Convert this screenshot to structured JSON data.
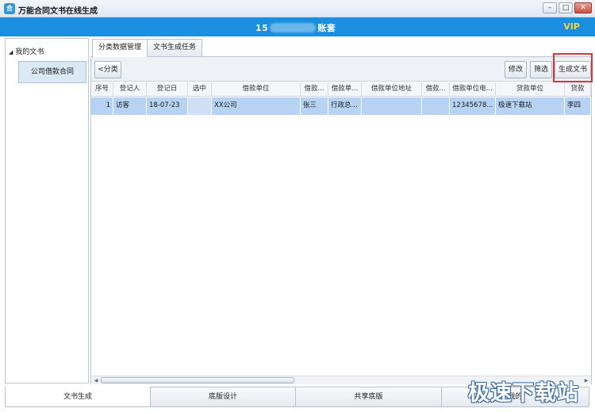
{
  "window": {
    "title": "万能合同文书在线生成",
    "app_icon_label": "合",
    "controls": {
      "minimize": "–",
      "maximize": "□",
      "close": "✕"
    }
  },
  "header": {
    "account_prefix": "15",
    "account_suffix": "账套",
    "vip": "VIP"
  },
  "tree": {
    "root_label": "我的文书",
    "child_label": "公司借款合同"
  },
  "tabs": [
    "分类数据管理",
    "文书生成任务"
  ],
  "toolbar": {
    "category_button": "<分类",
    "edit_button": "修改",
    "filter_button": "筛选",
    "generate_button": "生成文书"
  },
  "table": {
    "columns": [
      "序号",
      "登记人",
      "登记日",
      "选中",
      "借款单位",
      "借款...",
      "借款单...",
      "借款单位地址",
      "借款...",
      "借款单位电...",
      "贷款单位",
      "贷款"
    ],
    "rows": [
      [
        "1",
        "访客",
        "18-07-23",
        "",
        "XX公司",
        "张三",
        "行政总...",
        "",
        "",
        "12345678...",
        "极速下载站",
        "李四"
      ]
    ]
  },
  "bottom_tabs": [
    "文书生成",
    "底版设计",
    "共享底版",
    "我的"
  ],
  "watermark": "极速下载站",
  "colors": {
    "header_blue": "#1a8fe0",
    "vip_gold": "#f2d33b",
    "highlight_red": "#e03232",
    "row_selected": "#b7d3f4"
  }
}
